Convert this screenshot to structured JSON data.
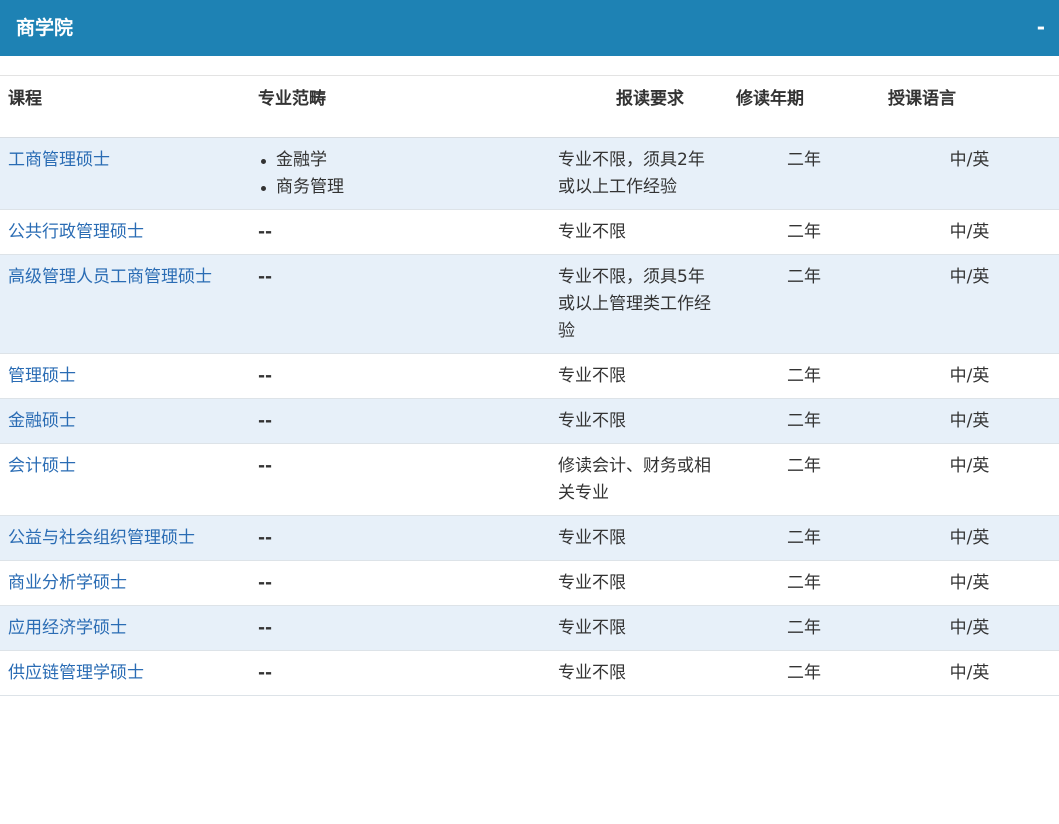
{
  "header": {
    "title": "商学院",
    "toggle": "-"
  },
  "table": {
    "columns": [
      "课程",
      "专业范畴",
      "报读要求",
      "修读年期",
      "授课语言"
    ],
    "rows": [
      {
        "course": "工商管理硕士",
        "categories": [
          "金融学",
          "商务管理"
        ],
        "requirement": "专业不限，须具2年或以上工作经验",
        "duration": "二年",
        "language": "中/英"
      },
      {
        "course": "公共行政管理硕士",
        "categories": [],
        "category_text": "--",
        "requirement": "专业不限",
        "duration": "二年",
        "language": "中/英"
      },
      {
        "course": "高级管理人员工商管理硕士",
        "categories": [],
        "category_text": "--",
        "requirement": "专业不限，须具5年或以上管理类工作经验",
        "duration": "二年",
        "language": "中/英"
      },
      {
        "course": "管理硕士",
        "categories": [],
        "category_text": "--",
        "requirement": "专业不限",
        "duration": "二年",
        "language": "中/英"
      },
      {
        "course": "金融硕士",
        "categories": [],
        "category_text": "--",
        "requirement": "专业不限",
        "duration": "二年",
        "language": "中/英"
      },
      {
        "course": "会计硕士",
        "categories": [],
        "category_text": "--",
        "requirement": "修读会计、财务或相关专业",
        "duration": "二年",
        "language": "中/英"
      },
      {
        "course": "公益与社会组织管理硕士",
        "categories": [],
        "category_text": "--",
        "requirement": "专业不限",
        "duration": "二年",
        "language": "中/英"
      },
      {
        "course": "商业分析学硕士",
        "categories": [],
        "category_text": "--",
        "requirement": "专业不限",
        "duration": "二年",
        "language": "中/英"
      },
      {
        "course": "应用经济学硕士",
        "categories": [],
        "category_text": "--",
        "requirement": "专业不限",
        "duration": "二年",
        "language": "中/英"
      },
      {
        "course": "供应链管理学硕士",
        "categories": [],
        "category_text": "--",
        "requirement": "专业不限",
        "duration": "二年",
        "language": "中/英"
      }
    ]
  },
  "colors": {
    "header_bg": "#1e82b4",
    "row_alt_bg": "#e7f0f9",
    "link": "#2a6cb4"
  }
}
